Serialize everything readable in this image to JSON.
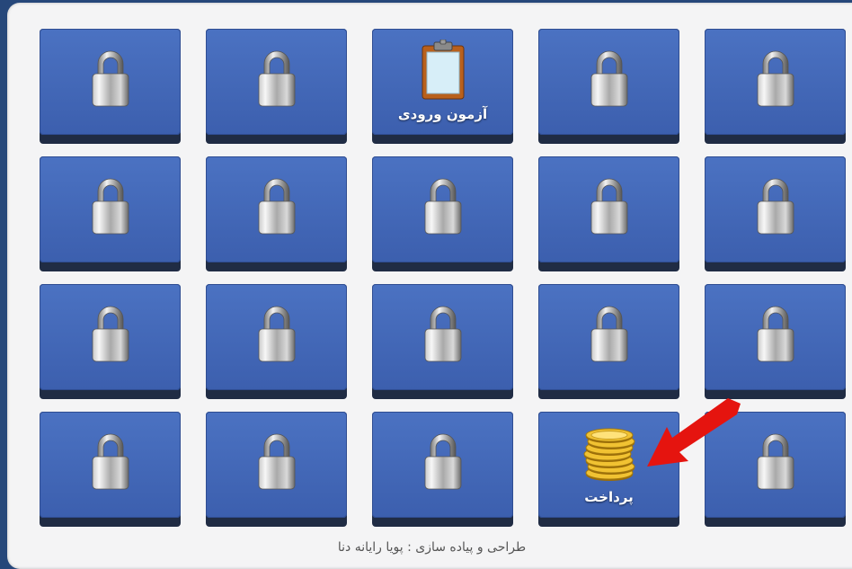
{
  "tiles": [
    {
      "icon": "lock-icon",
      "label": ""
    },
    {
      "icon": "lock-icon",
      "label": ""
    },
    {
      "icon": "clipboard-icon",
      "label": "آزمون ورودی"
    },
    {
      "icon": "lock-icon",
      "label": ""
    },
    {
      "icon": "lock-icon",
      "label": ""
    },
    {
      "icon": "lock-icon",
      "label": ""
    },
    {
      "icon": "lock-icon",
      "label": ""
    },
    {
      "icon": "lock-icon",
      "label": ""
    },
    {
      "icon": "lock-icon",
      "label": ""
    },
    {
      "icon": "lock-icon",
      "label": ""
    },
    {
      "icon": "lock-icon",
      "label": ""
    },
    {
      "icon": "lock-icon",
      "label": ""
    },
    {
      "icon": "lock-icon",
      "label": ""
    },
    {
      "icon": "lock-icon",
      "label": ""
    },
    {
      "icon": "lock-icon",
      "label": ""
    },
    {
      "icon": "lock-icon",
      "label": ""
    },
    {
      "icon": "lock-icon",
      "label": ""
    },
    {
      "icon": "lock-icon",
      "label": ""
    },
    {
      "icon": "coins-icon",
      "label": "پرداخت"
    },
    {
      "icon": "lock-icon",
      "label": ""
    }
  ],
  "footer": {
    "credit": "طراحی و پیاده سازی : پویا رایانه دنا"
  },
  "colors": {
    "tile": "#4468b8",
    "tile_shadow": "#202c44",
    "background": "#26477a",
    "panel": "#f4f4f5",
    "arrow": "#e5140f"
  }
}
